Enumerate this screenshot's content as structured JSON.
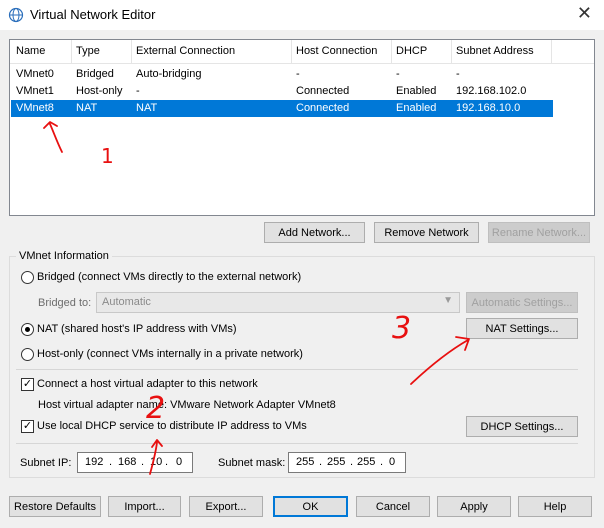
{
  "window": {
    "title": "Virtual Network Editor",
    "close_glyph": "✕"
  },
  "columns": [
    "Name",
    "Type",
    "External Connection",
    "Host Connection",
    "DHCP",
    "Subnet Address"
  ],
  "rows": [
    {
      "name": "VMnet0",
      "type": "Bridged",
      "external": "Auto-bridging",
      "host": "-",
      "dhcp": "-",
      "subnet": "-"
    },
    {
      "name": "VMnet1",
      "type": "Host-only",
      "external": "-",
      "host": "Connected",
      "dhcp": "Enabled",
      "subnet": "192.168.102.0"
    },
    {
      "name": "VMnet8",
      "type": "NAT",
      "external": "NAT",
      "host": "Connected",
      "dhcp": "Enabled",
      "subnet": "192.168.10.0"
    }
  ],
  "list_buttons": {
    "add": "Add Network...",
    "remove": "Remove Network",
    "rename": "Rename Network..."
  },
  "info": {
    "title": "VMnet Information",
    "bridged_label": "Bridged (connect VMs directly to the external network)",
    "bridged_to_label": "Bridged to:",
    "bridged_to_value": "Automatic",
    "auto_settings": "Automatic Settings...",
    "nat_label": "NAT (shared host's IP address with VMs)",
    "nat_settings": "NAT Settings...",
    "hostonly_label": "Host-only (connect VMs internally in a private network)",
    "connect_adapter_label": "Connect a host virtual adapter to this network",
    "adapter_name_label": "Host virtual adapter name: VMware Network Adapter VMnet8",
    "dhcp_label": "Use local DHCP service to distribute IP address to VMs",
    "dhcp_settings": "DHCP Settings...",
    "subnet_ip_label": "Subnet IP:",
    "subnet_ip": [
      "192",
      "168",
      "10",
      "0"
    ],
    "subnet_mask_label": "Subnet mask:",
    "subnet_mask": [
      "255",
      "255",
      "255",
      "0"
    ]
  },
  "bottom_buttons": {
    "restore": "Restore Defaults",
    "import": "Import...",
    "export": "Export...",
    "ok": "OK",
    "cancel": "Cancel",
    "apply": "Apply",
    "help": "Help"
  },
  "annotations": [
    "1",
    "2",
    "3"
  ],
  "colors": {
    "selection": "#0078d7",
    "annotation": "#e81010"
  }
}
